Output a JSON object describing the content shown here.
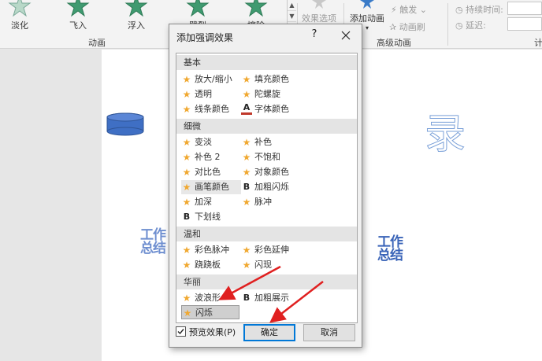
{
  "ribbon": {
    "effects": [
      {
        "label": "淡化",
        "icon": "fade-star-icon"
      },
      {
        "label": "飞入",
        "icon": "fly-in-star-icon"
      },
      {
        "label": "浮入",
        "icon": "float-in-star-icon"
      },
      {
        "label": "劈裂",
        "icon": "split-star-icon"
      },
      {
        "label": "擦除",
        "icon": "wipe-star-icon"
      }
    ],
    "effect_options": "效果选项",
    "add_animation": "添加动画",
    "trigger": "触发",
    "animation_painter": "动画刷",
    "duration_label": "持续时间:",
    "delay_label": "延迟:",
    "group_animation": "动画",
    "group_advanced": "高级动画",
    "group_timing_partial": "计"
  },
  "slide": {
    "text_left": "工作总结",
    "text_right": "工作总结",
    "text_big": "录"
  },
  "dialog": {
    "title": "添加强调效果",
    "help": "?",
    "categories": [
      {
        "name": "基本",
        "items": [
          {
            "label": "放大/缩小",
            "icon": "star"
          },
          {
            "label": "填充颜色",
            "icon": "star"
          },
          {
            "label": "透明",
            "icon": "star"
          },
          {
            "label": "陀螺旋",
            "icon": "star"
          },
          {
            "label": "线条颜色",
            "icon": "star"
          },
          {
            "label": "字体颜色",
            "icon": "font-color"
          }
        ]
      },
      {
        "name": "细微",
        "items": [
          {
            "label": "变淡",
            "icon": "star"
          },
          {
            "label": "补色",
            "icon": "star"
          },
          {
            "label": "补色 2",
            "icon": "star"
          },
          {
            "label": "不饱和",
            "icon": "star"
          },
          {
            "label": "对比色",
            "icon": "star"
          },
          {
            "label": "对象颜色",
            "icon": "star"
          },
          {
            "label": "画笔颜色",
            "icon": "star"
          },
          {
            "label": "加粗闪烁",
            "icon": "bold"
          },
          {
            "label": "加深",
            "icon": "star"
          },
          {
            "label": "脉冲",
            "icon": "star"
          },
          {
            "label": "下划线",
            "icon": "bold"
          }
        ]
      },
      {
        "name": "温和",
        "items": [
          {
            "label": "彩色脉冲",
            "icon": "star"
          },
          {
            "label": "彩色延伸",
            "icon": "star"
          },
          {
            "label": "跷跷板",
            "icon": "star"
          },
          {
            "label": "闪现",
            "icon": "star"
          }
        ]
      },
      {
        "name": "华丽",
        "items": [
          {
            "label": "波浪形",
            "icon": "star"
          },
          {
            "label": "加粗展示",
            "icon": "bold"
          },
          {
            "label": "闪烁",
            "icon": "star"
          }
        ]
      }
    ],
    "preview_label": "预览效果(P)",
    "preview_checked": true,
    "ok": "确定",
    "cancel": "取消",
    "selected_item": "闪烁"
  },
  "colors": {
    "star": "#f0a830",
    "accent": "#0078d7",
    "arrow": "#e02020",
    "shape_fill": "#3f6fc4",
    "slide_text": "#3a64b8"
  }
}
